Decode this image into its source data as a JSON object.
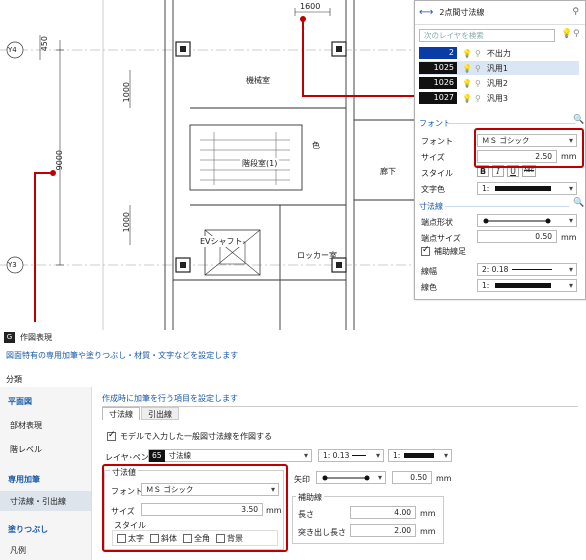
{
  "cad": {
    "dim_top": "1600",
    "dim_left": "450",
    "dim_side": "9000",
    "dim_small_1": "1000",
    "dim_small_2": "1000",
    "grid_y4": "Y4",
    "grid_y3": "Y3",
    "room_machine": "機械室",
    "room_stairs": "階段室(1)",
    "room_corridor": "廊下",
    "room_ev": "EVシャフト",
    "room_locker": "ロッカー室",
    "stair_mark": "色"
  },
  "panel": {
    "title": "2点間寸法線",
    "search_placeholder": "次のレイヤを検索",
    "layers": [
      {
        "num": "2",
        "name": "不出力"
      },
      {
        "num": "1025",
        "name": "汎用1"
      },
      {
        "num": "1026",
        "name": "汎用2"
      },
      {
        "num": "1027",
        "name": "汎用3"
      }
    ],
    "font_section": "フォント",
    "font_label": "フォント",
    "font_value": "ＭＳ ゴシック",
    "size_label": "サイズ",
    "size_value": "2.50",
    "size_unit": "mm",
    "style_label": "スタイル",
    "style_buttons": [
      "B",
      "I",
      "U",
      "ABC"
    ],
    "color_label": "文字色",
    "color_value": "1:",
    "dimline_section": "寸法線",
    "endpoint_shape_label": "端点形状",
    "endpoint_size_label": "端点サイズ",
    "endpoint_size_value": "0.50",
    "endpoint_size_unit": "mm",
    "aux_line_label": "補助線足",
    "line_width_label": "線幅",
    "line_width_value": "2: 0.18",
    "line_color_label": "線色",
    "line_color_value": "1:"
  },
  "dialog": {
    "title": "作図表現",
    "description": "図面特有の専用加筆や塗りつぶし・材質・文字などを設定します",
    "category_label": "分類",
    "nav": [
      {
        "label": "平面図",
        "head": true
      },
      {
        "label": "部材表現",
        "head": false
      },
      {
        "label": "階レベル",
        "head": false
      },
      {
        "label": "専用加筆",
        "head": true
      },
      {
        "label": "寸法線・引出線",
        "head": false
      },
      {
        "label": "塗りつぶし",
        "head": true
      },
      {
        "label": "凡例",
        "head": false
      }
    ],
    "content_desc": "作成時に加筆を行う項目を設定します",
    "tabs": [
      "寸法線",
      "引出線"
    ],
    "model_checkbox": "モデルで入力した一般図寸法線を作図する",
    "layer_pen_label": "レイヤ･ペン",
    "layer_num": "65",
    "layer_name": "寸法線",
    "line_type_1": "1: 0.13",
    "line_type_2": "1:",
    "dim_value_group": "寸法値",
    "font_label": "フォント",
    "font_value": "ＭＳ ゴシック",
    "size_label": "サイズ",
    "size_value": "3.50",
    "size_unit": "mm",
    "style_group": "スタイル",
    "styles": [
      "太字",
      "斜体",
      "全角",
      "背景"
    ],
    "arrow_label": "矢印",
    "arrow_size": "0.50",
    "arrow_unit": "mm",
    "aux_group": "補助線",
    "length_label": "長さ",
    "length_value": "4.00",
    "length_unit": "mm",
    "protrude_label": "突き出し長さ",
    "protrude_value": "2.00",
    "protrude_unit": "mm"
  }
}
